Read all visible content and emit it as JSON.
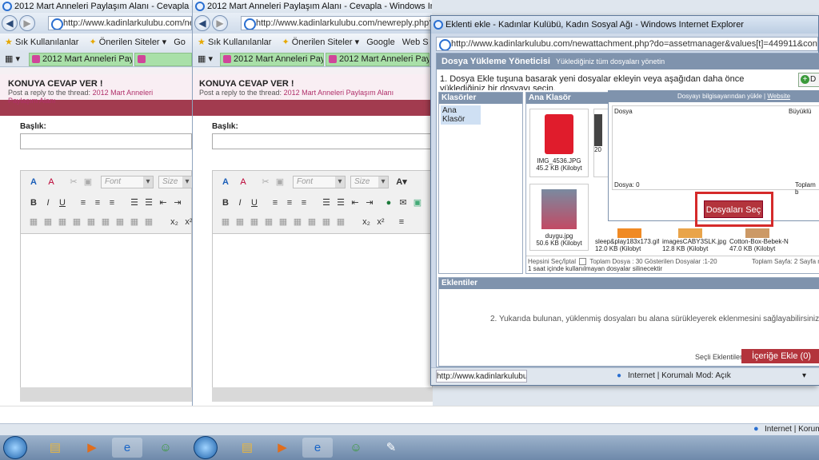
{
  "window1": {
    "title": "2012 Mart Anneleri Paylaşım Alanı - Cevapla - Windows",
    "address": "http://www.kadinlarkulubu.com/newrep",
    "fav_label": "Sık Kullanılanlar",
    "suggested": "Önerilen Siteler",
    "google": "Go",
    "tab": "2012 Mart Anneleri Paylaşı..."
  },
  "window2": {
    "title": "2012 Mart Anneleri Paylaşım Alanı - Cevapla - Windows Internet Explorer",
    "address": "http://www.kadinlarkulubu.com/newreply.php?p=2303",
    "fav_label": "Sık Kullanılanlar",
    "suggested": "Önerilen Siteler",
    "google": "Google",
    "webs": "Web S",
    "tab1": "2012 Mart Anneleri Paylaşı...",
    "tab2": "2012 Mart Anneleri Paylaşı..."
  },
  "reply": {
    "heading": "KONUYA CEVAP VER !",
    "subline": "Post a reply to the thread:",
    "thread": "2012 Mart Anneleri Paylaşım Alanı",
    "subject_label": "Başlık:",
    "font_placeholder": "Font",
    "size_placeholder": "Size"
  },
  "popup": {
    "title": "Eklenti ekle - Kadınlar Kulübü, Kadın Sosyal Ağı - Windows Internet Explorer",
    "address": "http://www.kadinlarkulubu.com/newattachment.php?do=assetmanager&values[t]=449911&contenttypeid=1&post",
    "header_title": "Dosya Yükleme Yöneticisi",
    "header_sub": "Yüklediğiniz tüm dosyaları yönetin",
    "instructions": "1. Dosya Ekle tuşuna basarak yeni dosyalar ekleyin veya aşağıdan daha önce yüklediğiniz bir dosyayı seçin.",
    "add_btn": "D",
    "folders_title": "Klasörler",
    "folder_item": "Ana Klasör",
    "main_folder": "Ana Klasör",
    "thumbs": [
      {
        "name": "IMG_4536.JPG",
        "size": "45.2 KB (Kilobyt"
      },
      {
        "name": "",
        "size": "20"
      },
      {
        "name": "duygu.jpg",
        "size": "50.6 KB (Kilobyt"
      },
      {
        "name": "sleep&play183x173.gif",
        "size": "12.0 KB (Kilobyt"
      },
      {
        "name": "imagesCABY3SLK.jpg",
        "size": "12.8 KB (Kilobyt"
      },
      {
        "name": "Cotton-Box-Bebek-N",
        "size": "47.0 KB (Kilobyt"
      }
    ],
    "select_all": "Hepsini Seç/İptal",
    "total_files": "Toplam Dosya : 30 Gösterilen Dosyalar :1-20",
    "total_pages": "Toplam Sayfa: 2 Sayfa n",
    "unused_note": "1 saat içinde kullanılmayan dosyalar silinecektir",
    "upload_title": "Dosyayı bilgisayarından yükle |",
    "upload_website": "Website",
    "col_file": "Dosya",
    "col_size": "Büyüklü",
    "file_count": "Dosya: 0",
    "total": "Toplam b",
    "choose_btn": "Dosyaları Seç",
    "attach_title": "Eklentiler",
    "attach_hint": "2. Yukarıda bulunan, yüklenmiş dosyaları bu alana sürükleyerek eklenmesini sağlayabilirsiniz.",
    "selected_label": "Seçli Eklentiler :",
    "insert_btn": "İçeriğe Ekle (0)",
    "status_url": "http://www.kadinlarkulubu.c",
    "status_zone": "Internet | Korumalı Mod: Açık",
    "zoom": "▾"
  },
  "status_right": "Internet | Korumalı"
}
